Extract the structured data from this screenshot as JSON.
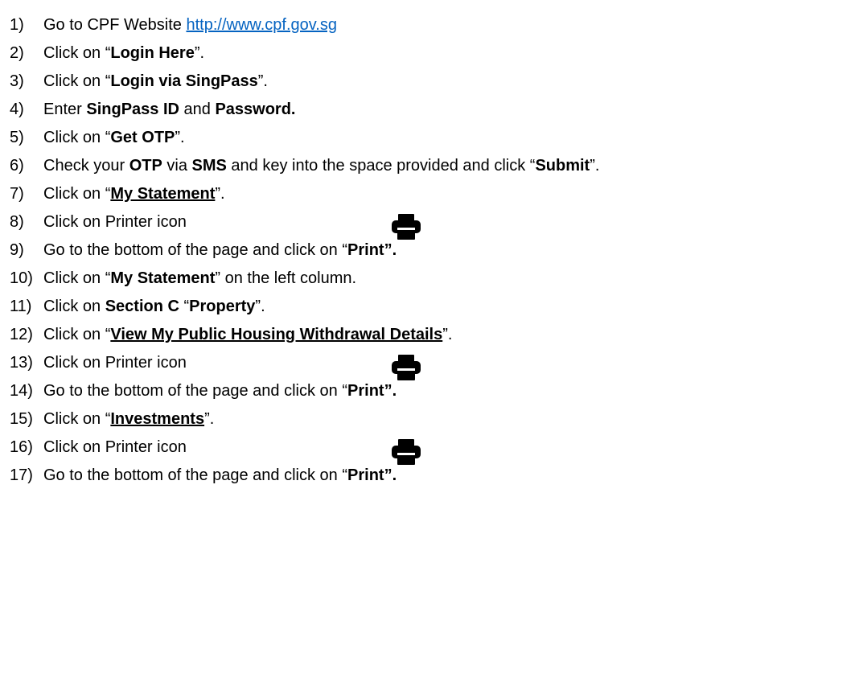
{
  "steps": [
    {
      "num": "1)",
      "parts": [
        {
          "t": "Go to CPF Website "
        },
        {
          "t": "http://www.cpf.gov.sg",
          "link": true
        }
      ]
    },
    {
      "num": "2)",
      "parts": [
        {
          "t": "Click on “"
        },
        {
          "t": "Login Here",
          "b": true
        },
        {
          "t": "”."
        }
      ]
    },
    {
      "num": "3)",
      "parts": [
        {
          "t": "Click on “"
        },
        {
          "t": "Login via SingPass",
          "b": true
        },
        {
          "t": "”."
        }
      ]
    },
    {
      "num": "4)",
      "parts": [
        {
          "t": "Enter "
        },
        {
          "t": "SingPass ID",
          "b": true
        },
        {
          "t": " and "
        },
        {
          "t": "Password.",
          "b": true
        }
      ]
    },
    {
      "num": "5)",
      "parts": [
        {
          "t": "Click on “"
        },
        {
          "t": "Get OTP",
          "b": true
        },
        {
          "t": "”."
        }
      ]
    },
    {
      "num": "6)",
      "parts": [
        {
          "t": "Check your "
        },
        {
          "t": "OTP",
          "b": true
        },
        {
          "t": " via "
        },
        {
          "t": "SMS",
          "b": true
        },
        {
          "t": " and key into the space provided and click “"
        },
        {
          "t": "Submit",
          "b": true
        },
        {
          "t": "”."
        }
      ]
    },
    {
      "num": "7)",
      "parts": [
        {
          "t": "Click on “"
        },
        {
          "t": "My Statement",
          "b": true,
          "u": true
        },
        {
          "t": "”."
        }
      ]
    },
    {
      "num": "8)",
      "parts": [
        {
          "t": "Click on Printer icon"
        }
      ],
      "icon": "printer-icon"
    },
    {
      "num": "9)",
      "parts": [
        {
          "t": "Go to the bottom of the page and click on “"
        },
        {
          "t": "Print”.",
          "b": true
        }
      ]
    },
    {
      "num": "10)",
      "parts": [
        {
          "t": "Click on “"
        },
        {
          "t": "My Statement",
          "b": true
        },
        {
          "t": "” on the left column."
        }
      ]
    },
    {
      "num": "11)",
      "parts": [
        {
          "t": "Click on "
        },
        {
          "t": "Section C",
          "b": true
        },
        {
          "t": " “"
        },
        {
          "t": "Property",
          "b": true
        },
        {
          "t": "”."
        }
      ]
    },
    {
      "num": "12)",
      "parts": [
        {
          "t": "Click on “"
        },
        {
          "t": "View My Public Housing Withdrawal Details",
          "b": true,
          "u": true
        },
        {
          "t": "”."
        }
      ]
    },
    {
      "num": "13)",
      "parts": [
        {
          "t": "Click on Printer icon"
        }
      ],
      "icon": "printer-icon"
    },
    {
      "num": "14)",
      "parts": [
        {
          "t": "Go to the bottom of the page and click on “"
        },
        {
          "t": "Print”.",
          "b": true
        }
      ]
    },
    {
      "num": "15)",
      "parts": [
        {
          "t": "Click on “"
        },
        {
          "t": "Investments",
          "b": true,
          "u": true
        },
        {
          "t": "”."
        }
      ]
    },
    {
      "num": "16)",
      "parts": [
        {
          "t": "Click on Printer icon"
        }
      ],
      "icon": "printer-icon"
    },
    {
      "num": "17)",
      "parts": [
        {
          "t": "Go to the bottom of the page and click on “"
        },
        {
          "t": "Print”.",
          "b": true
        }
      ]
    }
  ]
}
